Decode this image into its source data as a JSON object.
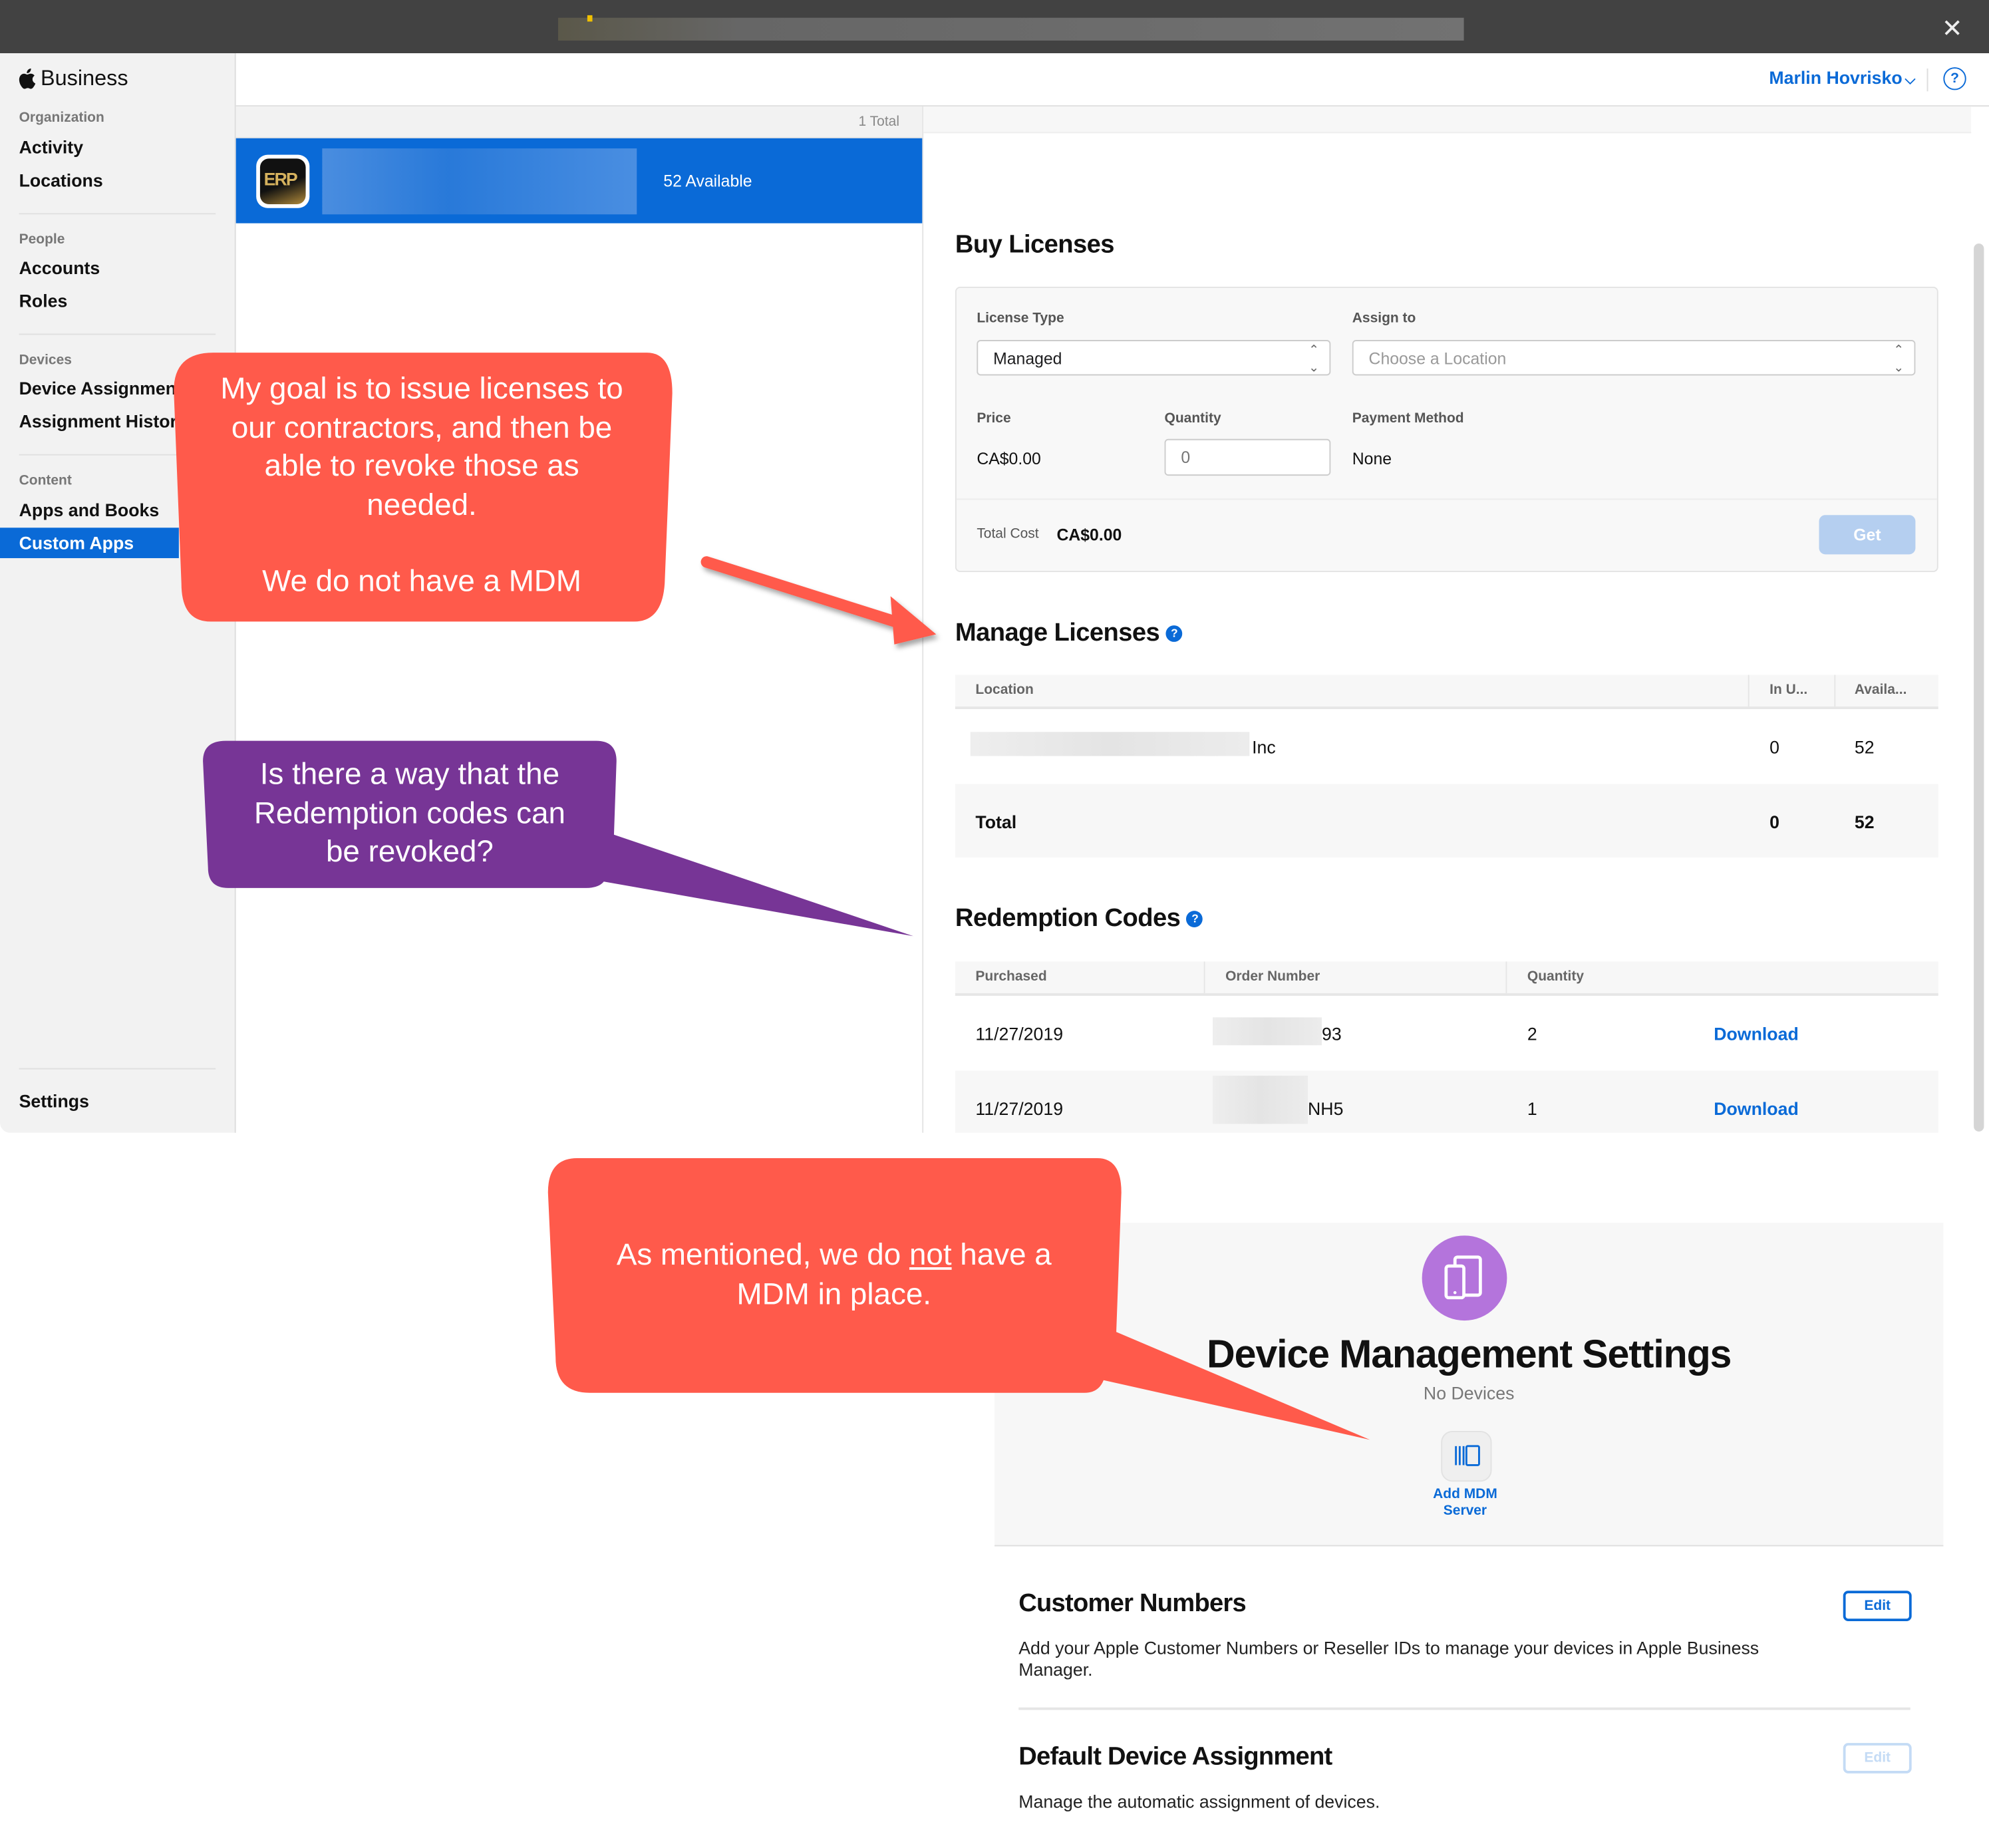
{
  "window": {
    "close_icon": "close-icon",
    "url_redacted": true
  },
  "sidebar": {
    "brand": "Business",
    "sections": [
      {
        "label": "Organization",
        "items": [
          {
            "label": "Activity"
          },
          {
            "label": "Locations"
          }
        ]
      },
      {
        "label": "People",
        "items": [
          {
            "label": "Accounts"
          },
          {
            "label": "Roles"
          }
        ]
      },
      {
        "label": "Devices",
        "items": [
          {
            "label": "Device Assignments"
          },
          {
            "label": "Assignment History"
          }
        ]
      },
      {
        "label": "Content",
        "items": [
          {
            "label": "Apps and Books"
          },
          {
            "label": "Custom Apps",
            "active": true
          }
        ]
      }
    ],
    "settings": "Settings"
  },
  "header": {
    "user_name": "Marlin Hovrisko",
    "help_glyph": "?"
  },
  "app_list": {
    "total": "1 Total",
    "items": [
      {
        "icon_text": "ERP",
        "name_redacted": true,
        "available": "52 Available",
        "selected": true
      }
    ]
  },
  "buy_licenses": {
    "title": "Buy Licenses",
    "license_type_label": "License Type",
    "license_type_value": "Managed",
    "assign_to_label": "Assign to",
    "assign_to_placeholder": "Choose a Location",
    "price_label": "Price",
    "price_value": "CA$0.00",
    "quantity_label": "Quantity",
    "quantity_placeholder": "0",
    "payment_method_label": "Payment Method",
    "payment_method_value": "None",
    "total_cost_label": "Total Cost",
    "total_cost_value": "CA$0.00",
    "get_button": "Get"
  },
  "manage_licenses": {
    "title": "Manage Licenses",
    "columns": [
      "Location",
      "In U...",
      "Availa..."
    ],
    "rows": [
      {
        "location_suffix": "Inc",
        "location_redacted": true,
        "in_use": "0",
        "available": "52"
      }
    ],
    "total": {
      "label": "Total",
      "in_use": "0",
      "available": "52"
    }
  },
  "redemption_codes": {
    "title": "Redemption Codes",
    "columns": [
      "Purchased",
      "Order Number",
      "Quantity"
    ],
    "rows": [
      {
        "purchased": "11/27/2019",
        "order_suffix": "93",
        "quantity": "2",
        "action": "Download"
      },
      {
        "purchased": "11/27/2019",
        "order_suffix": "NH5",
        "quantity": "1",
        "action": "Download"
      }
    ]
  },
  "device_management": {
    "title": "Device Management Settings",
    "subtitle": "No Devices",
    "add_mdm_line1": "Add MDM",
    "add_mdm_line2": "Server"
  },
  "customer_numbers": {
    "title": "Customer Numbers",
    "body": "Add your Apple Customer Numbers or Reseller IDs to manage your devices in Apple Business Manager.",
    "edit": "Edit"
  },
  "default_assignment": {
    "title": "Default Device Assignment",
    "body": "Manage the automatic assignment of devices.",
    "edit": "Edit"
  },
  "annotations": {
    "callout1_lines": [
      "My goal is to issue licenses to",
      "our contractors,  and then be",
      "able to revoke those as",
      "needed.",
      "",
      "We do not have a MDM"
    ],
    "callout2_lines": [
      "Is there a way that the",
      "Redemption codes can",
      "be revoked?"
    ],
    "callout3_pre": "As mentioned, we do ",
    "callout3_underlined": "not",
    "callout3_post": " have a",
    "callout3_line2": "MDM in place.",
    "red_color": "#ff5a4b",
    "purple_color": "#773596"
  },
  "colors": {
    "accent": "#0a6ad7",
    "sidebar_bg": "#f2f2f2",
    "titlebar": "#424242",
    "mdm_icon": "#b474dc"
  }
}
